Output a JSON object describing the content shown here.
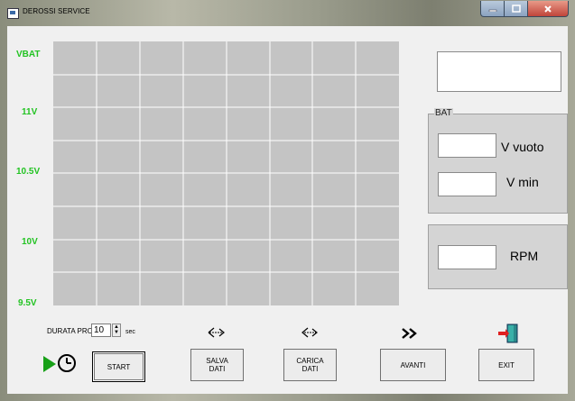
{
  "window": {
    "title": "DEROSSI SERVICE"
  },
  "axis": {
    "labels": [
      "VBAT",
      "11V",
      "10.5V",
      "10V",
      "9.5V"
    ]
  },
  "bat_group": {
    "label": "BAT",
    "v_vuoto_label": "V vuoto",
    "v_min_label": "V min"
  },
  "rpm": {
    "label": "RPM"
  },
  "duration": {
    "label": "DURATA PROVA",
    "value": "10",
    "unit": "sec"
  },
  "buttons": {
    "start": "START",
    "salva": "SALVA DATI",
    "carica": "CARICA DATI",
    "avanti": "AVANTI",
    "exit": "EXIT"
  },
  "icons": {
    "start": "clock-play-icon",
    "salva": "arrow-out-icon",
    "carica": "arrow-in-icon",
    "avanti": "double-chevron-icon",
    "exit": "exit-door-icon"
  },
  "colors": {
    "axis_label": "#22c322",
    "grid_bg": "#c4c4c4",
    "grid_line": "#ffffff"
  }
}
